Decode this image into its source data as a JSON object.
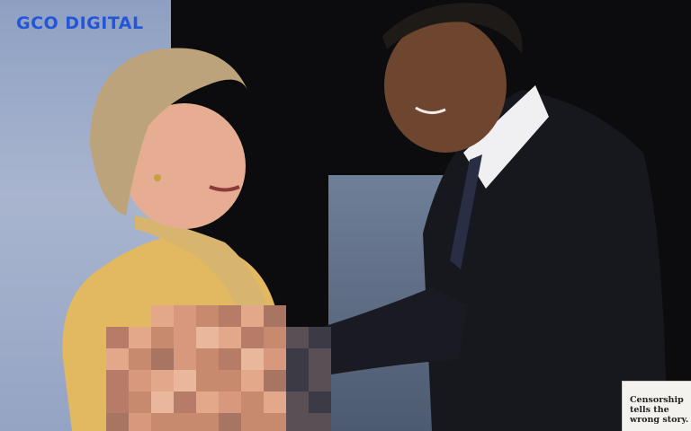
{
  "watermark": {
    "text": "GCO DIGITAL",
    "color": "#2456d8"
  },
  "ad_card": {
    "text": "Censorship\ntells the\nwrong story."
  },
  "colors": {
    "background_dark": "#0c0c0e",
    "backdrop_blue": "#9aa8c8",
    "coat_yellow": "#e0b85c",
    "suit_black": "#15161c",
    "skin": "#e0ad8c"
  }
}
